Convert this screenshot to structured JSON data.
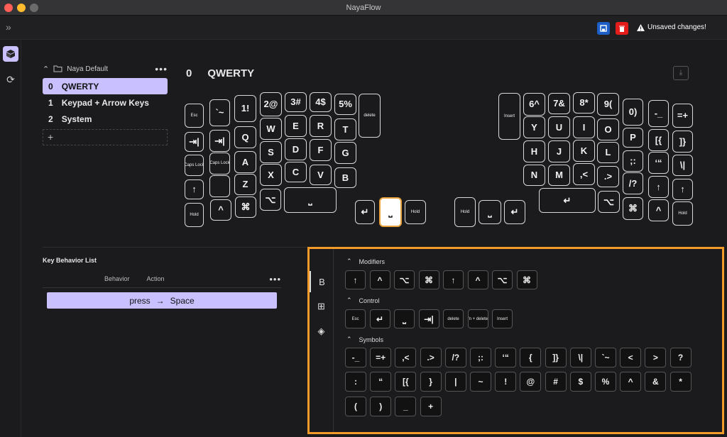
{
  "window": {
    "title": "NayaFlow"
  },
  "toolbar": {
    "expand_icon": "»",
    "unsaved": "Unsaved changes!",
    "save_color": "#1d5fc7",
    "discard_color": "#e51c1c"
  },
  "layers": {
    "profile": "Naya Default",
    "items": [
      {
        "index": "0",
        "name": "QWERTY"
      },
      {
        "index": "1",
        "name": "Keypad + Arrow Keys"
      },
      {
        "index": "2",
        "name": "System"
      }
    ],
    "add": "+"
  },
  "current_layer": {
    "index": "0",
    "name": "QWERTY"
  },
  "keyboard": {
    "left": [
      [
        "Esc",
        "`~",
        "1!",
        "2@",
        "3#",
        "4$",
        "5%",
        "delete"
      ],
      [
        "⇥|",
        "⇥|",
        "Q",
        "W",
        "E",
        "R",
        "T"
      ],
      [
        "Caps Lock",
        "Caps Lock",
        "A",
        "S",
        "D",
        "F",
        "G"
      ],
      [
        "↑",
        "",
        "Z",
        "X",
        "C",
        "V",
        "B"
      ],
      [
        "Hold",
        "^",
        "⌘",
        "⌥",
        "⎵"
      ],
      [
        "↵",
        "⎵",
        "Hold"
      ]
    ],
    "right": [
      [
        "Insert",
        "6^",
        "7&",
        "8*",
        "9(",
        "0)",
        "-_",
        "=+"
      ],
      [
        "Y",
        "U",
        "I",
        "O",
        "P",
        "[{",
        "]}"
      ],
      [
        "H",
        "J",
        "K",
        "L",
        ";:",
        "‘“",
        "\\|"
      ],
      [
        "N",
        "M",
        ",<",
        ".>",
        "/?",
        "↑",
        "↑"
      ],
      [
        "↵",
        "⌥",
        "⌘",
        "^",
        "Hold"
      ],
      [
        "Hold",
        "⎵",
        "↵"
      ]
    ]
  },
  "key_behavior": {
    "title": "Key Behavior List",
    "col_behavior": "Behavior",
    "col_action": "Action",
    "rows": [
      {
        "behavior": "press",
        "arrow": "→",
        "action": "Space"
      }
    ]
  },
  "picker": {
    "tabs": [
      "B",
      "⊞",
      "◈"
    ],
    "sections": {
      "modifiers": "Modifiers",
      "control": "Control",
      "symbols": "Symbols"
    },
    "modifiers": [
      "↑",
      "^",
      "⌥",
      "⌘",
      "↑",
      "^",
      "⌥",
      "⌘"
    ],
    "control": [
      "Esc",
      "↵",
      "⎵",
      "⇥|",
      "delete",
      "fn + delete",
      "Insert"
    ],
    "symbols": [
      "-_",
      "=+",
      ",<",
      ".>",
      "/?",
      ";:",
      "‘“",
      "{",
      "]}",
      "\\|",
      "`~",
      "<",
      ">",
      "?",
      ":",
      "“",
      "[{",
      "}",
      "|",
      "~",
      "!",
      "@",
      "#",
      "$",
      "%",
      "^",
      "&",
      "*",
      "(",
      ")",
      "_",
      "+"
    ]
  },
  "accent": "#c9c0ff"
}
